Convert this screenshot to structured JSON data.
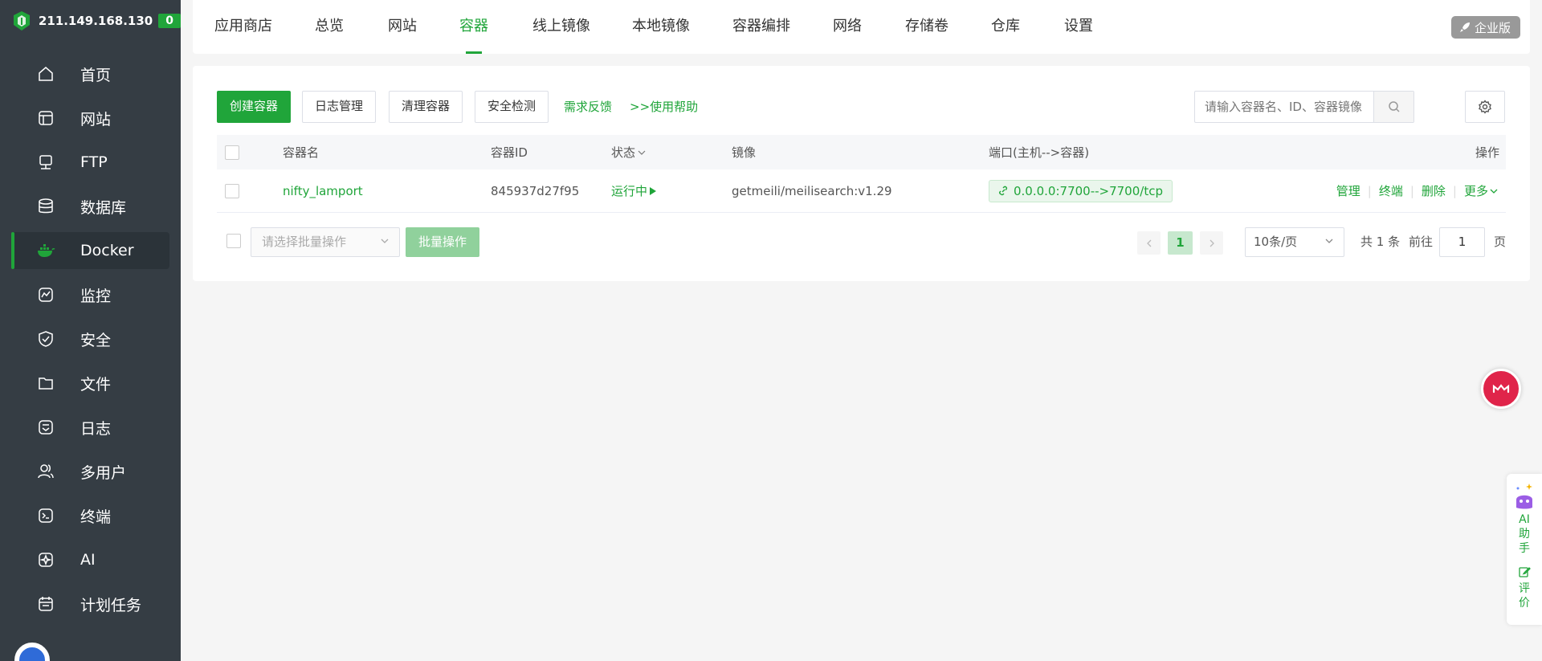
{
  "sidebar": {
    "server_ip": "211.149.168.130",
    "badge": "0",
    "items": [
      {
        "label": "首页",
        "icon": "home-icon"
      },
      {
        "label": "网站",
        "icon": "website-icon"
      },
      {
        "label": "FTP",
        "icon": "ftp-icon"
      },
      {
        "label": "数据库",
        "icon": "database-icon"
      },
      {
        "label": "Docker",
        "icon": "docker-icon"
      },
      {
        "label": "监控",
        "icon": "monitor-icon"
      },
      {
        "label": "安全",
        "icon": "shield-icon"
      },
      {
        "label": "文件",
        "icon": "folder-icon"
      },
      {
        "label": "日志",
        "icon": "log-icon"
      },
      {
        "label": "多用户",
        "icon": "users-icon"
      },
      {
        "label": "终端",
        "icon": "terminal-icon"
      },
      {
        "label": "AI",
        "icon": "ai-icon"
      },
      {
        "label": "计划任务",
        "icon": "calendar-icon"
      }
    ]
  },
  "topnav": {
    "tabs": [
      "应用商店",
      "总览",
      "网站",
      "容器",
      "线上镜像",
      "本地镜像",
      "容器编排",
      "网络",
      "存储卷",
      "仓库",
      "设置"
    ],
    "active_tab": "容器",
    "enterprise_label": "企业版"
  },
  "toolbar": {
    "create_label": "创建容器",
    "log_label": "日志管理",
    "clean_label": "清理容器",
    "security_label": "安全检测",
    "feedback_label": "需求反馈",
    "help_label": ">>使用帮助",
    "search_placeholder": "请输入容器名、ID、容器镜像"
  },
  "table": {
    "headers": {
      "name": "容器名",
      "id": "容器ID",
      "status": "状态",
      "image": "镜像",
      "port": "端口(主机-->容器)",
      "ops": "操作"
    },
    "rows": [
      {
        "name": "nifty_lamport",
        "id": "845937d27f95",
        "status": "运行中",
        "image": "getmeili/meilisearch:v1.29",
        "port": "0.0.0.0:7700-->7700/tcp",
        "ops": {
          "manage": "管理",
          "terminal": "终端",
          "delete": "删除",
          "more": "更多"
        }
      }
    ]
  },
  "footer": {
    "batch_placeholder": "请选择批量操作",
    "batch_btn": "批量操作",
    "current_page": "1",
    "page_size": "10条/页",
    "total": "共 1 条",
    "goto_label": "前往",
    "goto_value": "1",
    "page_suffix": "页"
  },
  "ai_panel": {
    "ai_label": "AI助手",
    "rate_label": "评价"
  },
  "colors": {
    "primary": "#20a53a",
    "sidebar_bg": "#353d44"
  }
}
